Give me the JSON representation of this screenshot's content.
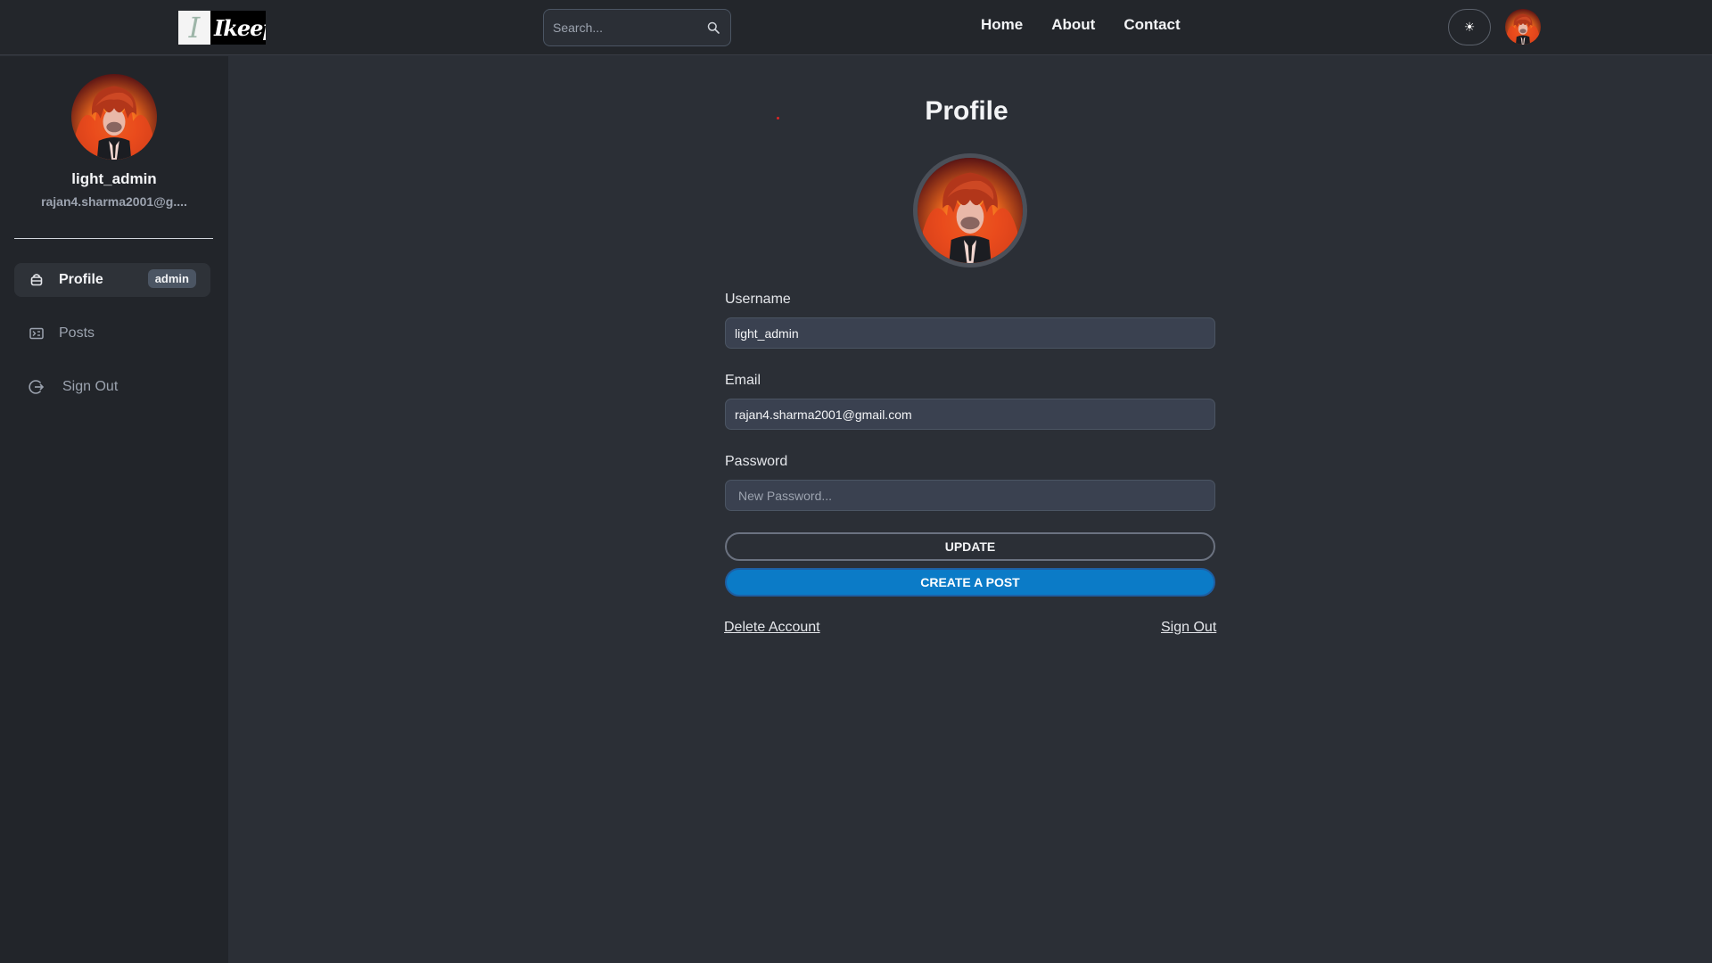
{
  "header": {
    "logo_letter": "I",
    "logo_text": "Ikeep",
    "search_placeholder": "Search...",
    "nav": [
      {
        "label": "Home"
      },
      {
        "label": "About"
      },
      {
        "label": "Contact"
      }
    ],
    "theme_icon": "☀"
  },
  "sidebar": {
    "username": "light_admin",
    "email": "rajan4.sharma2001@g....",
    "items": [
      {
        "label": "Profile",
        "icon": "user-icon",
        "badge": "admin",
        "active": true
      },
      {
        "label": "Posts",
        "icon": "posts-icon"
      },
      {
        "label": "Sign Out",
        "icon": "sign-out-icon"
      }
    ]
  },
  "main": {
    "title": "Profile",
    "username_label": "Username",
    "username_value": "light_admin",
    "email_label": "Email",
    "email_value": "rajan4.sharma2001@gmail.com",
    "password_label": "Password",
    "password_placeholder": "New Password...",
    "update_label": "UPDATE",
    "create_label": "CREATE A POST",
    "delete_label": "Delete Account",
    "signout_label": "Sign Out"
  },
  "colors": {
    "background": "#2b2f36",
    "header_bg": "#23262b",
    "sidebar_bg": "#22252a",
    "accent": "#0b7bc7"
  }
}
